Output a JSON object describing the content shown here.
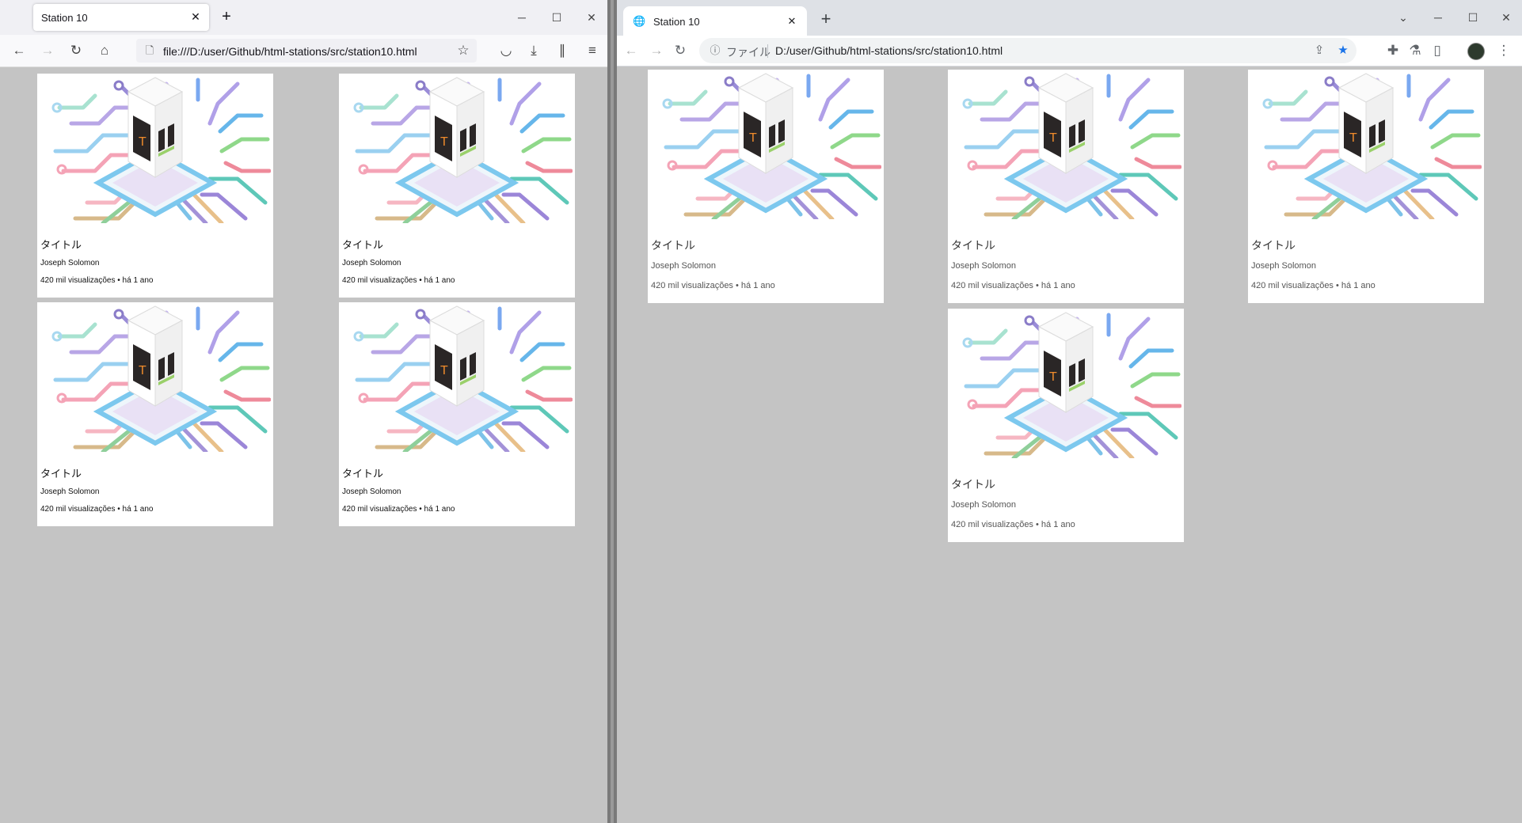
{
  "left_browser": {
    "tab_title": "Station 10",
    "url": "file:///D:/user/Github/html-stations/src/station10.html"
  },
  "right_browser": {
    "tab_title": "Station 10",
    "url_prefix": "ファイル",
    "url": "D:/user/Github/html-stations/src/station10.html"
  },
  "icons": {
    "back": "arrow-left-icon",
    "forward": "arrow-right-icon",
    "reload": "reload-icon",
    "home": "home-icon",
    "bookmark": "star-icon",
    "pocket": "pocket-icon",
    "download": "download-icon",
    "library": "library-icon",
    "menu": "hamburger-icon",
    "share": "share-icon",
    "extensions": "puzzle-icon",
    "labs": "flask-icon",
    "sidepanel": "side-panel-icon",
    "more": "kebab-icon"
  },
  "colors": {
    "page_bg": "#c4c4c4",
    "card_bg": "#ffffff",
    "chrome_star": "#1a73e8"
  },
  "videos": [
    {
      "title": "タイトル",
      "author": "Joseph Solomon",
      "meta": "420 mil visualizações • há 1 ano"
    },
    {
      "title": "タイトル",
      "author": "Joseph Solomon",
      "meta": "420 mil visualizações • há 1 ano"
    },
    {
      "title": "タイトル",
      "author": "Joseph Solomon",
      "meta": "420 mil visualizações • há 1 ano"
    },
    {
      "title": "タイトル",
      "author": "Joseph Solomon",
      "meta": "420 mil visualizações • há 1 ano"
    }
  ]
}
